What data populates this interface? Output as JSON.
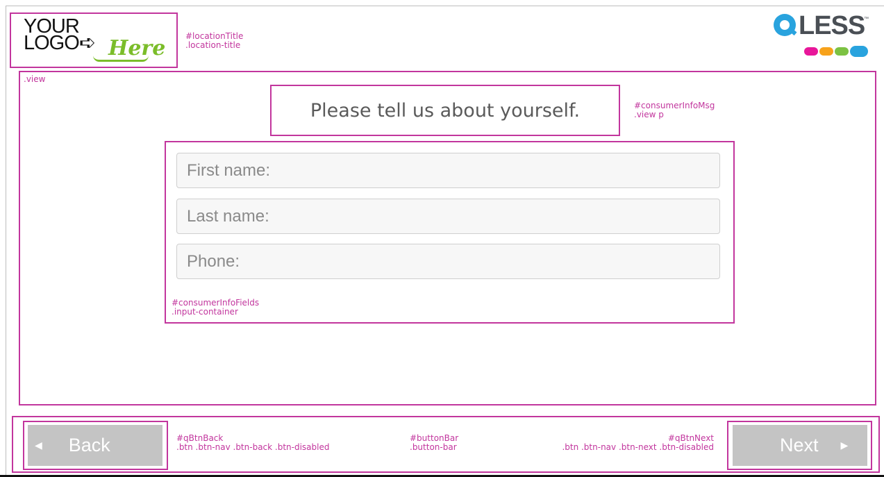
{
  "header": {
    "logo": {
      "line1": "YOUR",
      "line2": "LOGO",
      "arrow": "➪",
      "accent": "Here"
    },
    "location_note": {
      "id": "#locationTitle",
      "cls": ".location-title"
    },
    "brand": {
      "name": "LESS",
      "tm": "™",
      "dots": [
        "#e8179a",
        "#f7a21b",
        "#7cc242",
        "#29a3de"
      ]
    }
  },
  "view": {
    "label": ".view",
    "message": "Please tell us about yourself.",
    "message_note": {
      "id": "#consumerInfoMsg",
      "cls": ".view p"
    },
    "fields": [
      {
        "placeholder": "First name:",
        "value": ""
      },
      {
        "placeholder": "Last name:",
        "value": ""
      },
      {
        "placeholder": "Phone:",
        "value": ""
      }
    ],
    "fields_note": {
      "id": "#consumerInfoFields",
      "cls": ".input-container"
    }
  },
  "button_bar": {
    "back_label": "Back",
    "next_label": "Next",
    "back_note": {
      "id": "#qBtnBack",
      "cls": ".btn .btn-nav .btn-back .btn-disabled"
    },
    "bar_note": {
      "id": "#buttonBar",
      "cls": ".button-bar"
    },
    "next_note": {
      "id": "#qBtnNext",
      "cls": ".btn .btn-nav .btn-next .btn-disabled"
    }
  },
  "colors": {
    "annotation": "#c2359d",
    "button_disabled": "#c4c4c4",
    "brand_blue": "#29a3de"
  }
}
